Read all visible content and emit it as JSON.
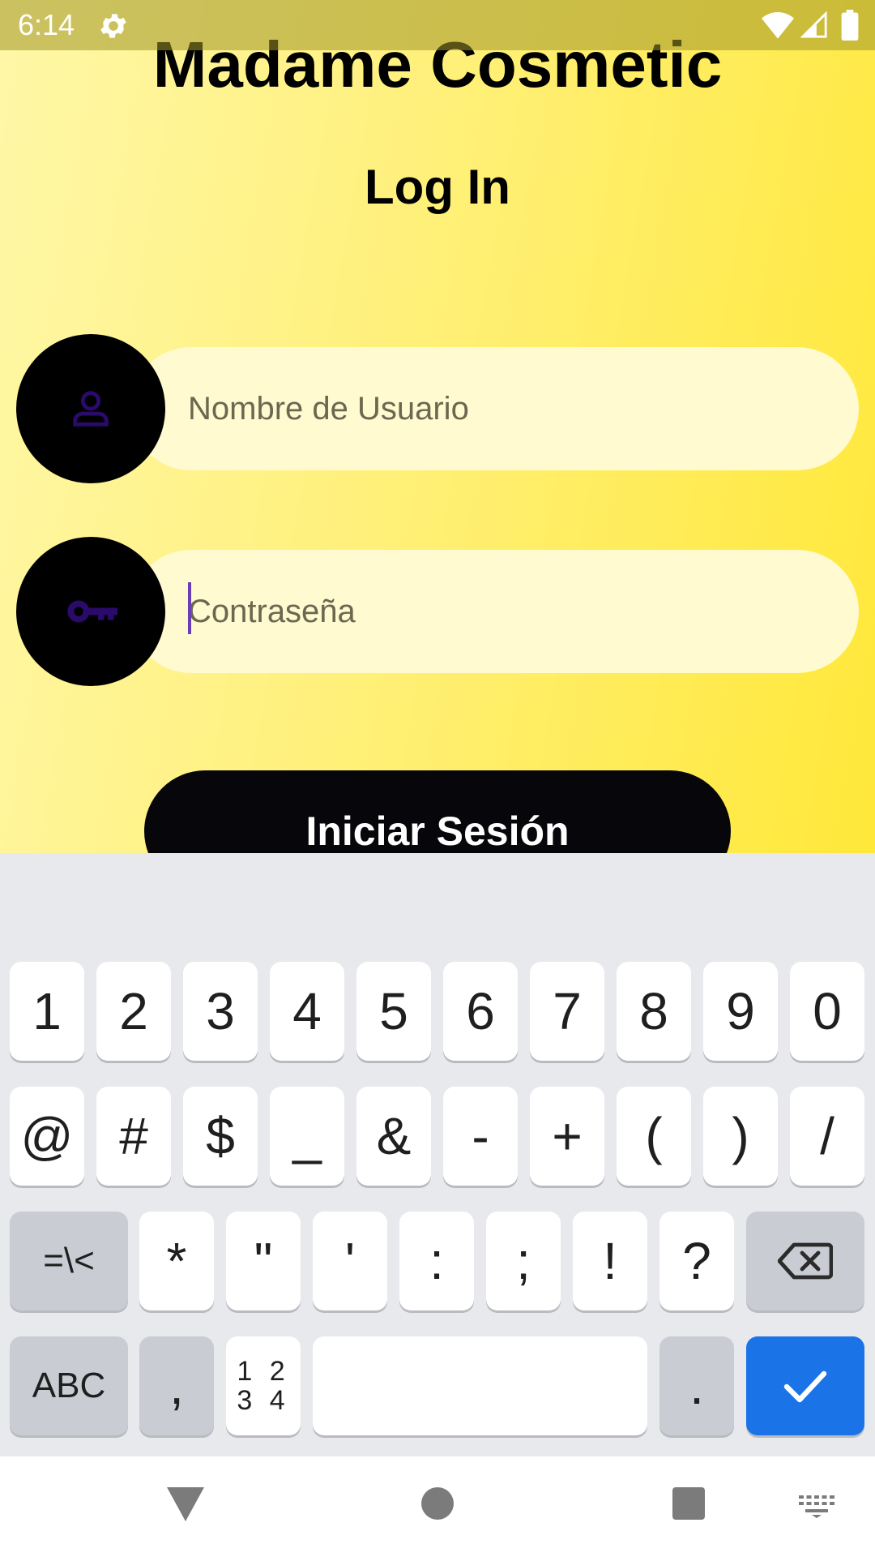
{
  "status_bar": {
    "time": "6:14",
    "icons": [
      "gear-icon",
      "wifi-icon",
      "signal-icon",
      "battery-icon"
    ]
  },
  "app": {
    "title": "Madame Cosmetic",
    "screen_title": "Log In",
    "username": {
      "placeholder": "Nombre de Usuario",
      "value": "",
      "icon": "user-icon"
    },
    "password": {
      "placeholder": "Contraseña",
      "value": "",
      "icon": "key-icon"
    },
    "login_button": "Iniciar Sesión"
  },
  "keyboard": {
    "row1": [
      "1",
      "2",
      "3",
      "4",
      "5",
      "6",
      "7",
      "8",
      "9",
      "0"
    ],
    "row2": [
      "@",
      "#",
      "$",
      "_",
      "&",
      "-",
      "+",
      "(",
      ")",
      "/"
    ],
    "row3": [
      "=\\<",
      "*",
      "\"",
      "'",
      ":",
      ";",
      "!",
      "?"
    ],
    "row3_backspace_icon": "backspace-icon",
    "row4": {
      "abc": "ABC",
      "comma": ",",
      "numpad_top": "1 2",
      "numpad_bottom": "3 4",
      "space": "",
      "period": ".",
      "enter_icon": "check-icon"
    }
  },
  "nav_bar": {
    "icons": [
      "back-icon",
      "home-icon",
      "recents-icon",
      "keyboard-switch-icon"
    ]
  },
  "colors": {
    "gradient_start": "#fff7a8",
    "gradient_end": "#ffe839",
    "field_bg": "#fffad0",
    "icon_purple": "#2a0a6b",
    "accent_blue": "#1b73e8"
  }
}
